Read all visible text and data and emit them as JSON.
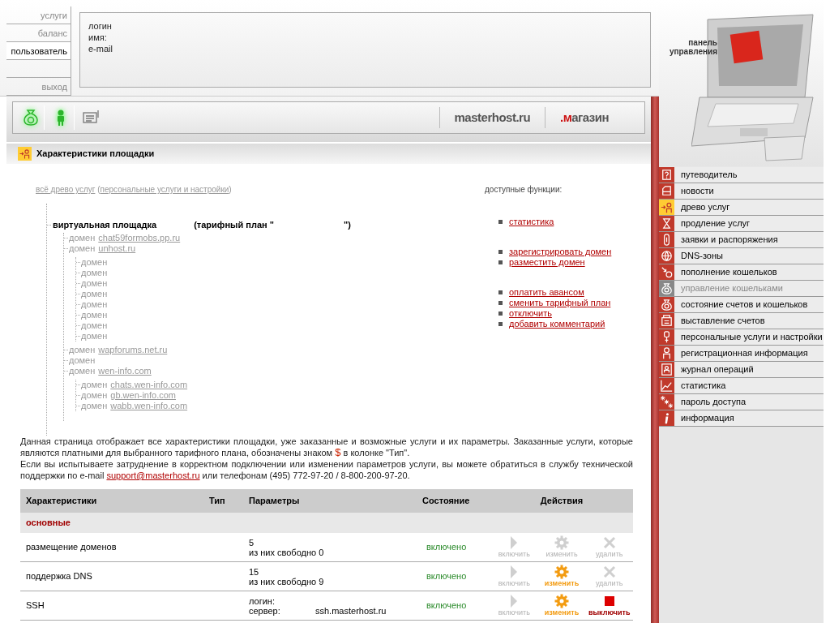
{
  "top_nav": [
    {
      "label": "услуги",
      "selected": false
    },
    {
      "label": "баланс",
      "selected": false
    },
    {
      "label": "пользователь",
      "selected": true
    },
    {
      "label": "выход",
      "selected": false
    }
  ],
  "user_info": {
    "lines": [
      "логин",
      "имя:",
      "e-mail"
    ]
  },
  "panel_logo": {
    "lines": [
      "панель",
      "управления"
    ]
  },
  "toolbar": {
    "icons": [
      {
        "kind": "money",
        "highlighted": true
      },
      {
        "kind": "person",
        "highlighted": true
      },
      {
        "kind": "message",
        "highlighted": false
      }
    ],
    "links": [
      {
        "text": "masterhost.ru"
      },
      {
        "accent": ".м",
        "text": "агазин"
      }
    ]
  },
  "page_title": "Характеристики площадки",
  "breadcrumb": [
    {
      "text": "всё древо услуг",
      "kind": "link"
    },
    {
      "text": " (",
      "kind": "text"
    },
    {
      "text": "персональные услуги и настройки",
      "kind": "link"
    },
    {
      "text": ")",
      "kind": "text"
    }
  ],
  "tree": {
    "label": "виртуальная площадка",
    "plan_open": "(тарифный план \"",
    "plan_close": "\")",
    "children": [
      {
        "prefix": "домен",
        "link": "chat59formobs.pp.ru"
      },
      {
        "prefix": "домен",
        "link": "unhost.ru",
        "children": [
          {
            "prefix": "домен"
          },
          {
            "prefix": "домен"
          },
          {
            "prefix": "домен"
          },
          {
            "prefix": "домен"
          },
          {
            "prefix": "домен"
          },
          {
            "prefix": "домен"
          },
          {
            "prefix": "домен"
          },
          {
            "prefix": "домен"
          }
        ]
      },
      {
        "prefix": "домен",
        "link": "wapforums.net.ru"
      },
      {
        "prefix": "домен"
      },
      {
        "prefix": "домен",
        "link": "wen-info.com",
        "children": [
          {
            "prefix": "домен",
            "link": "chats.wen-info.com"
          },
          {
            "prefix": "домен",
            "link": "gb.wen-info.com"
          },
          {
            "prefix": "домен",
            "link": "wabb.wen-info.com"
          }
        ]
      }
    ]
  },
  "functions": {
    "title": "доступные функции:",
    "groups": [
      [
        "статистика"
      ],
      [
        "зарегистрировать домен",
        "разместить домен"
      ],
      [
        "оплатить авансом",
        "сменить тарифный план",
        "отключить",
        "добавить комментарий"
      ]
    ]
  },
  "sidebar": {
    "items": [
      {
        "kind": "help",
        "label": "путеводитель",
        "selected": false,
        "disabled": false
      },
      {
        "kind": "news",
        "label": "новости",
        "selected": false,
        "disabled": false
      },
      {
        "kind": "tree",
        "label": "древо услуг",
        "selected": true,
        "disabled": false
      },
      {
        "kind": "hourglass",
        "label": "продление услуг",
        "selected": false,
        "disabled": false
      },
      {
        "kind": "requests",
        "label": "заявки и распоряжения",
        "selected": false,
        "disabled": false
      },
      {
        "kind": "dns",
        "label": "DNS-зоны",
        "selected": false,
        "disabled": false
      },
      {
        "kind": "topup",
        "label": "пополнение кошельков",
        "selected": false,
        "disabled": false
      },
      {
        "kind": "wallet",
        "label": "управление кошельками",
        "selected": false,
        "disabled": true
      },
      {
        "kind": "wallet",
        "label": "состояние счетов и кошельков",
        "selected": false,
        "disabled": false
      },
      {
        "kind": "invoice",
        "label": "выставление счетов",
        "selected": false,
        "disabled": false
      },
      {
        "kind": "settings",
        "label": "персональные услуги и настройки",
        "selected": false,
        "disabled": false
      },
      {
        "kind": "person",
        "label": "регистрационная информация",
        "selected": false,
        "disabled": false
      },
      {
        "kind": "journal",
        "label": "журнал операций",
        "selected": false,
        "disabled": false
      },
      {
        "kind": "stats",
        "label": "статистика",
        "selected": false,
        "disabled": false
      },
      {
        "kind": "password",
        "label": "пароль доступа",
        "selected": false,
        "disabled": false
      },
      {
        "kind": "info",
        "label": "информация",
        "selected": false,
        "disabled": false
      }
    ]
  },
  "description": [
    [
      {
        "kind": "text",
        "text": "Данная страница отображает все характеристики площадки, уже заказанные и возможные услуги и их параметры. Заказанные услуги, которые являются платными для выбранного тарифного плана, обозначены знаком "
      },
      {
        "kind": "accent",
        "text": "$"
      },
      {
        "kind": "text",
        "text": " в колонке \"Тип\"."
      }
    ],
    [
      {
        "kind": "text",
        "text": "Если вы испытываете затруднение в корректном подключении или изменении параметров услуги, вы можете обратиться в службу технической поддержки по e-mail "
      },
      {
        "kind": "link",
        "text": "support@masterhost.ru"
      },
      {
        "kind": "text",
        "text": " или телефонам (495) 772-97-20 / 8-800-200-97-20."
      }
    ]
  ],
  "table": {
    "columns": [
      "Характеристики",
      "Тип",
      "Параметры",
      "Состояние",
      "Действия"
    ],
    "group": "основные",
    "rows": [
      {
        "name": "размещение доменов",
        "params": [
          {
            "label": "5"
          },
          {
            "label": "из них свободно 0"
          }
        ],
        "status": "включено",
        "actions": [
          {
            "kind": "enable",
            "label": "включить",
            "enabled": false
          },
          {
            "kind": "edit",
            "label": "изменить",
            "enabled": false
          },
          {
            "kind": "delete",
            "label": "удалить",
            "enabled": false
          }
        ]
      },
      {
        "name": "поддержка DNS",
        "params": [
          {
            "label": "15"
          },
          {
            "label": "из них свободно 9"
          }
        ],
        "status": "включено",
        "actions": [
          {
            "kind": "enable",
            "label": "включить",
            "enabled": false
          },
          {
            "kind": "edit",
            "label": "изменить",
            "enabled": true
          },
          {
            "kind": "delete",
            "label": "удалить",
            "enabled": false
          }
        ]
      },
      {
        "name": "SSH",
        "params": [
          {
            "label": "логин:"
          },
          {
            "label": "сервер:",
            "value": "ssh.masterhost.ru"
          }
        ],
        "status": "включено",
        "actions": [
          {
            "kind": "enable",
            "label": "включить",
            "enabled": false
          },
          {
            "kind": "edit",
            "label": "изменить",
            "enabled": true
          },
          {
            "kind": "disable",
            "label": "выключить",
            "enabled": true
          }
        ]
      }
    ]
  }
}
